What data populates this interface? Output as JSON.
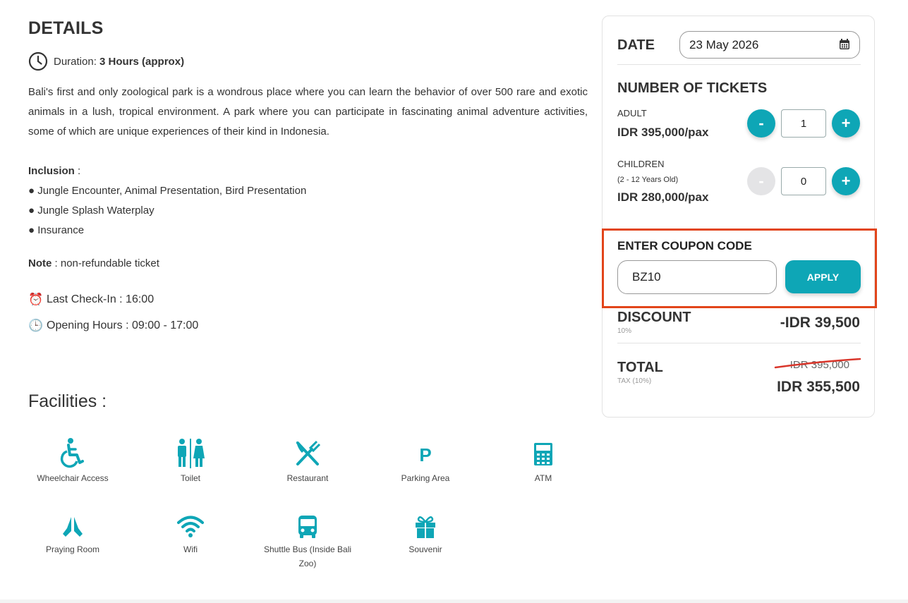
{
  "details": {
    "title": "DETAILS",
    "duration_label": "Duration",
    "duration_sep": ":",
    "duration_value": "3 Hours (approx)",
    "description": "Bali's first and only zoological park is a wondrous place where you can learn the behavior of over 500 rare and exotic animals in a lush, tropical environment. A park where you can participate in fascinating animal adventure activities, some of which are unique experiences of their kind in Indonesia.",
    "inclusion_label": "Inclusion",
    "inclusion_sep": " :",
    "inclusion_items": [
      "● Jungle Encounter, Animal Presentation, Bird Presentation",
      "● Jungle Splash Waterplay",
      "● Insurance"
    ],
    "note_label": "Note",
    "note_text": " : non-refundable ticket",
    "last_checkin": "Last Check-In : 16:00",
    "opening_hours": "Opening Hours : 09:00 - 17:00",
    "checkin_emoji": "⏰",
    "opening_emoji": "🕒"
  },
  "facilities": {
    "title": "Facilities :",
    "items": [
      {
        "label": "Wheelchair Access",
        "icon": "wheelchair-icon"
      },
      {
        "label": "Toilet",
        "icon": "toilet-icon"
      },
      {
        "label": "Restaurant",
        "icon": "restaurant-icon"
      },
      {
        "label": "Parking Area",
        "icon": "parking-icon"
      },
      {
        "label": "ATM",
        "icon": "atm-icon"
      },
      {
        "label": "Praying Room",
        "icon": "praying-icon"
      },
      {
        "label": "Wifi",
        "icon": "wifi-icon"
      },
      {
        "label": "Shuttle Bus (Inside Bali Zoo)",
        "icon": "bus-icon"
      },
      {
        "label": "Souvenir",
        "icon": "gift-icon"
      }
    ],
    "icon_color": "#0ea6b6"
  },
  "booking": {
    "date_label": "DATE",
    "date_value": "23 May 2026",
    "tickets_title": "NUMBER OF TICKETS",
    "adult": {
      "label": "ADULT",
      "price": "IDR 395,000/pax",
      "qty": "1",
      "minus": "-",
      "plus": "+"
    },
    "children": {
      "label": "CHILDREN",
      "sub": "(2 - 12 Years Old)",
      "price": "IDR 280,000/pax",
      "qty": "0",
      "minus": "-",
      "plus": "+"
    },
    "coupon_title": "ENTER COUPON CODE",
    "coupon_value": "BZ10",
    "apply_label": "APPLY",
    "discount_label": "DISCOUNT",
    "discount_sub": "10%",
    "discount_value": "-IDR 39,500",
    "total_label": "TOTAL",
    "total_sub": "TAX (10%)",
    "total_old": "IDR 395,000",
    "total_new": "IDR 355,500",
    "accent_color": "#0ea6b6",
    "highlight_color": "#e2451b"
  }
}
